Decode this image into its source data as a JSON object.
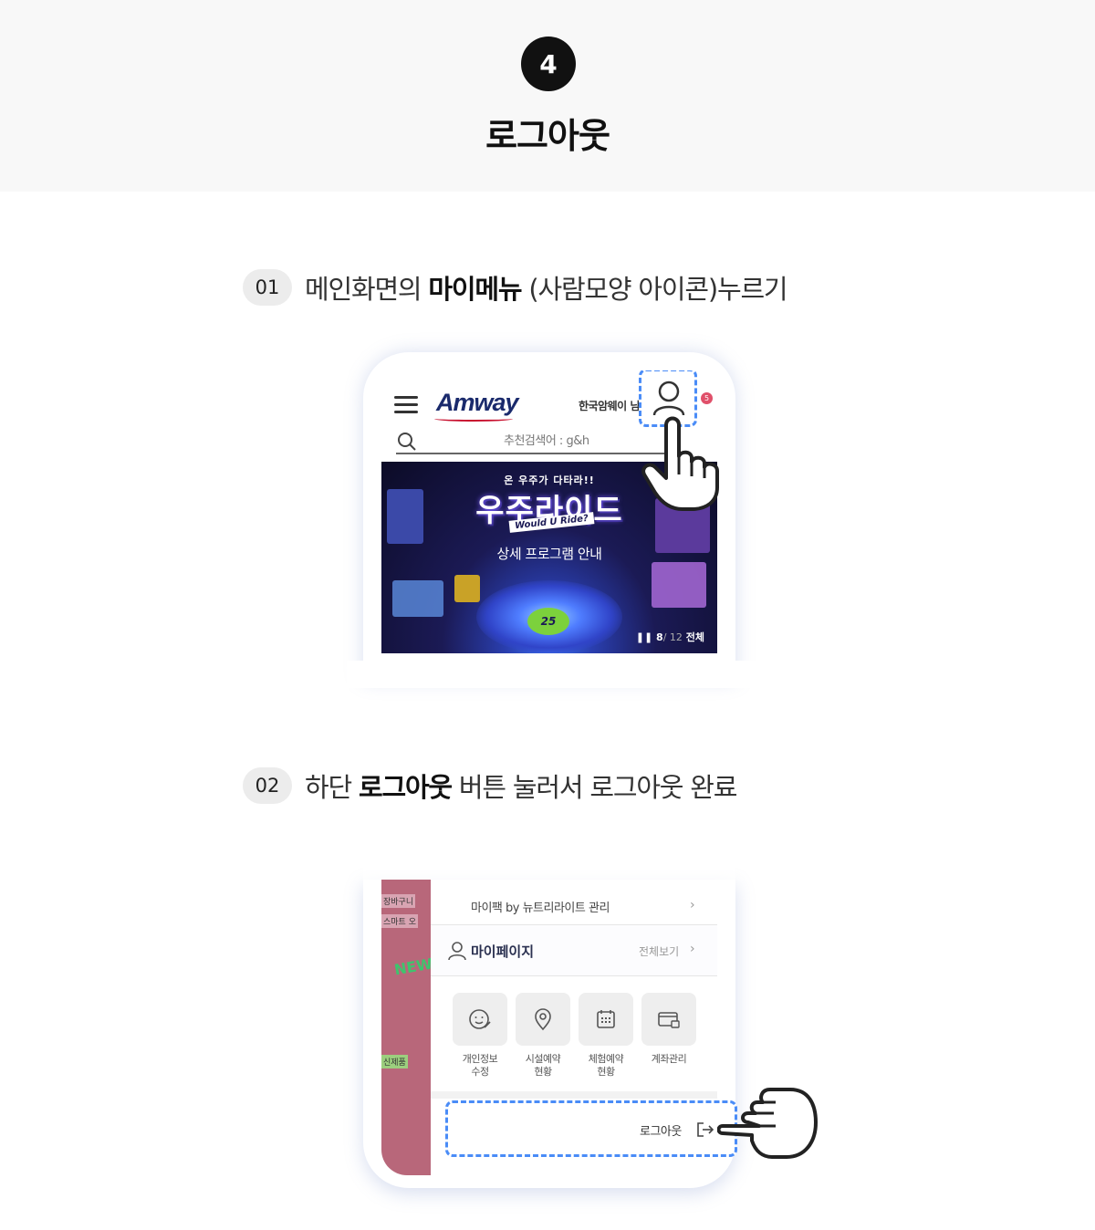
{
  "header": {
    "step_number": "4",
    "title": "로그아웃"
  },
  "step1": {
    "number": "01",
    "text_before": "메인화면의 ",
    "text_bold": "마이메뉴",
    "text_after": " (사람모양 아이콘)누르기",
    "screen": {
      "logo": "Amway",
      "greeting": "한국암웨이 님",
      "badge": "5",
      "search_placeholder": "추천검색어 : g&h",
      "banner_sub": "온 우주가 다타라!!",
      "banner_title": "우주라이드",
      "banner_tag": "Would U Ride?",
      "banner_cta": "상세 프로그램 안내",
      "banner_logo": "25",
      "counter_current": "8",
      "counter_total": "/ 12",
      "counter_all": "전체"
    }
  },
  "step2": {
    "number": "02",
    "text_before": "하단 ",
    "text_bold": "로그아웃",
    "text_after": " 버튼 눌러서 로그아웃 완료",
    "screen": {
      "left_labels": [
        "장바구니",
        "스마트 오",
        "신제품"
      ],
      "left_new": "NEW",
      "mypack": "마이팩 by 뉴트리라이트 관리",
      "mypage_title": "마이페이지",
      "view_all": "전체보기",
      "quick_actions": [
        {
          "label_1": "개인정보",
          "label_2": "수정",
          "icon": "smile-edit-icon"
        },
        {
          "label_1": "시설예약",
          "label_2": "현황",
          "icon": "location-pin-icon"
        },
        {
          "label_1": "체험예약",
          "label_2": "현황",
          "icon": "calendar-icon"
        },
        {
          "label_1": "계좌관리",
          "label_2": "",
          "icon": "card-lock-icon"
        }
      ],
      "logout_label": "로그아웃"
    }
  },
  "colors": {
    "dashed_highlight": "#4a8cf7",
    "step_circle": "#111111"
  }
}
